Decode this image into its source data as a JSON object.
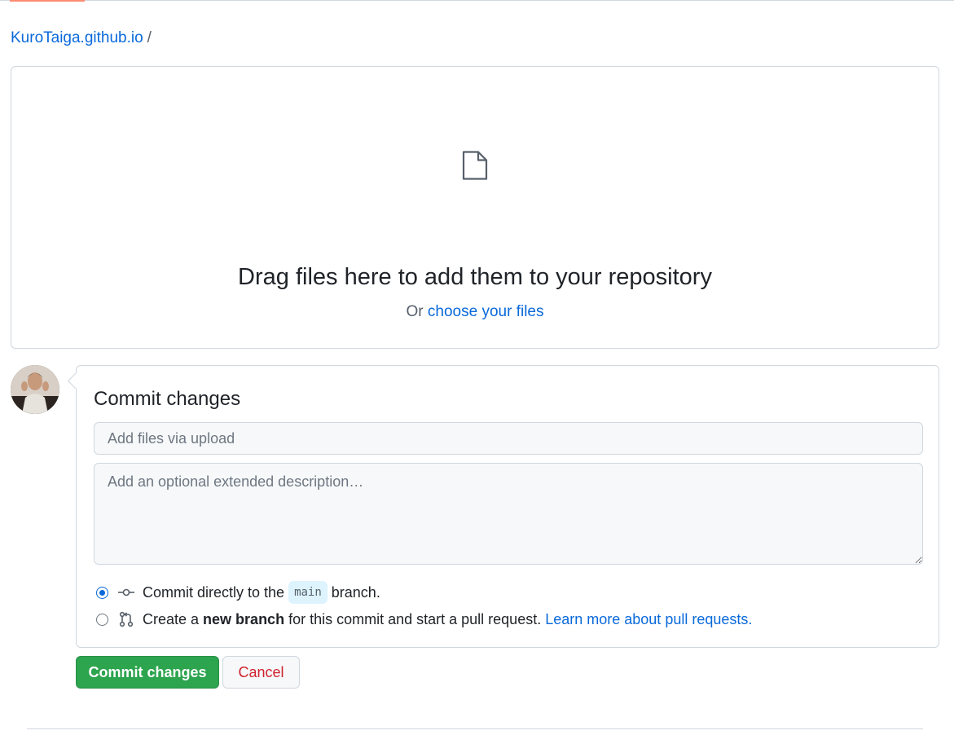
{
  "breadcrumb": {
    "repo": "KuroTaiga.github.io",
    "separator": "/"
  },
  "dropzone": {
    "icon": "file-icon",
    "title": "Drag files here to add them to your repository",
    "or_text": "Or",
    "choose_link": "choose your files"
  },
  "commit": {
    "title": "Commit changes",
    "summary_placeholder": "Add files via upload",
    "description_placeholder": "Add an optional extended description…",
    "option_direct": {
      "prefix": "Commit directly to the",
      "branch": "main",
      "suffix": "branch.",
      "selected": true,
      "icon": "git-commit-icon"
    },
    "option_new_branch": {
      "prefix": "Create a",
      "bold": "new branch",
      "suffix": "for this commit and start a pull request.",
      "link": "Learn more about pull requests.",
      "selected": false,
      "icon": "git-pull-request-icon"
    }
  },
  "buttons": {
    "commit_label": "Commit changes",
    "cancel_label": "Cancel"
  },
  "colors": {
    "link": "#0969da",
    "primary": "#2da44e",
    "danger": "#cf222e",
    "border": "#d0d7de"
  }
}
